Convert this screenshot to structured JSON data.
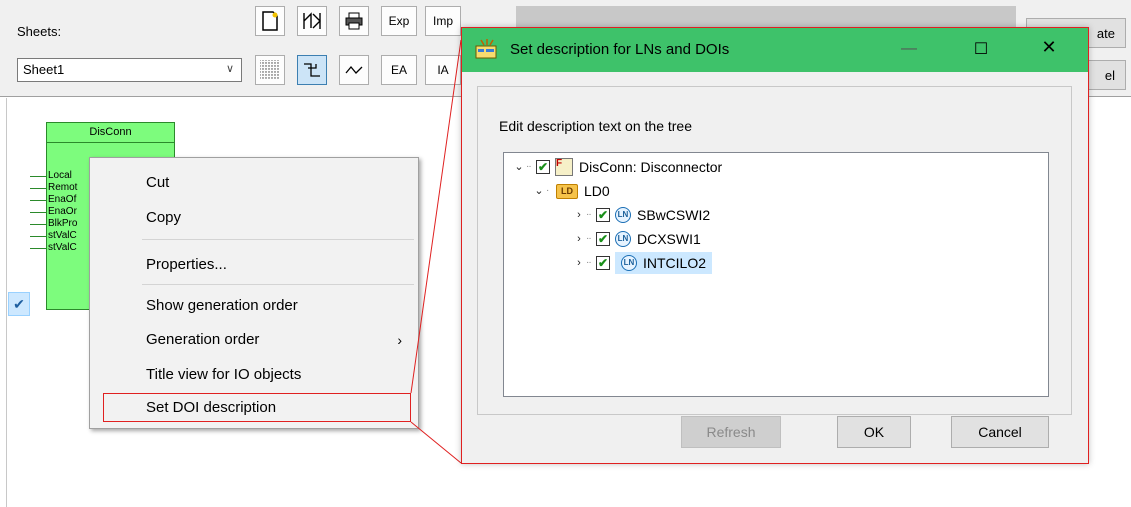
{
  "toolbar": {
    "sheets_label": "Sheets:",
    "sheet_selected": "Sheet1",
    "exp_label": "Exp",
    "imp_label": "Imp",
    "ea_label": "EA",
    "ia_label": "IA",
    "right_btn1_label": "ate",
    "right_btn2_label": "el"
  },
  "function_block": {
    "title": "DisConn",
    "pins": [
      "Local",
      "Remot",
      "EnaOf",
      "EnaOr",
      "BlkPro",
      "stValC",
      "stValC"
    ]
  },
  "context_menu": {
    "items": [
      {
        "label": "Cut"
      },
      {
        "label": "Copy"
      },
      {
        "label": "Properties..."
      },
      {
        "label": "Show generation order",
        "checked": true
      },
      {
        "label": "Generation order",
        "has_submenu": true
      },
      {
        "label": "Title view for IO objects"
      },
      {
        "label": "Set DOI description",
        "highlighted": true
      }
    ]
  },
  "dialog": {
    "title": "Set description for LNs and DOIs",
    "caption": "Edit description text on the tree",
    "tree": {
      "root": {
        "label": "DisConn: Disconnector",
        "icon": "function-icon",
        "checked": true,
        "expanded": true
      },
      "ld": {
        "label": "LD0",
        "badge": "LD",
        "expanded": true
      },
      "nodes": [
        {
          "label": "SBwCSWI2",
          "badge": "LN",
          "checked": true
        },
        {
          "label": "DCXSWI1",
          "badge": "LN",
          "checked": true
        },
        {
          "label": "INTCILO2",
          "badge": "LN",
          "checked": true,
          "selected": true
        }
      ]
    },
    "buttons": {
      "refresh": "Refresh",
      "ok": "OK",
      "cancel": "Cancel"
    }
  },
  "colors": {
    "title_bar": "#3ec26a",
    "function_block": "#7dfc7d",
    "highlight_border": "#e02020"
  }
}
